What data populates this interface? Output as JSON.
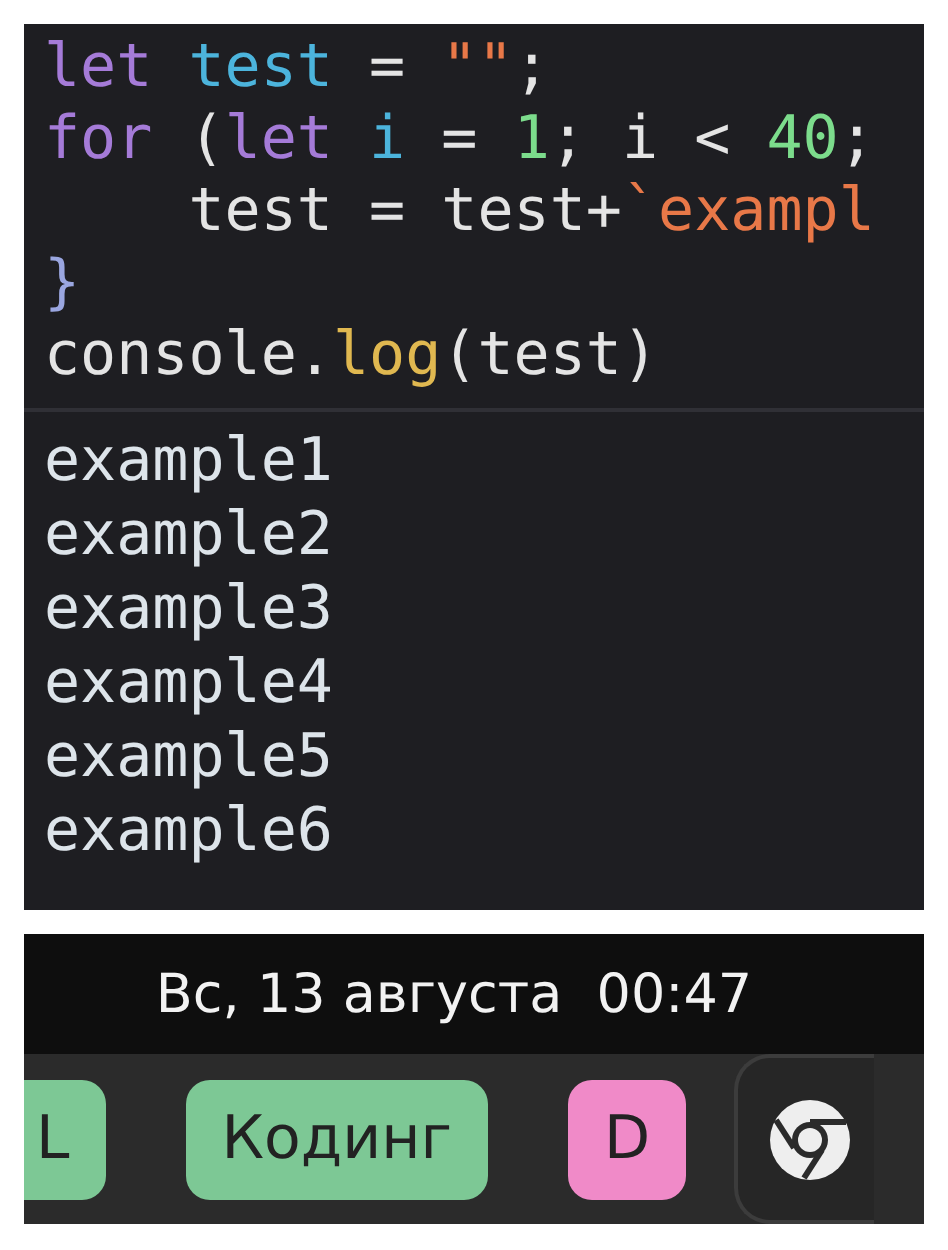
{
  "editor": {
    "code_lines": [
      [
        {
          "text": "let",
          "kind": "keyword"
        },
        {
          "text": " test",
          "kind": "variable"
        },
        {
          "text": " = ",
          "kind": "plain"
        },
        {
          "text": "\"\"",
          "kind": "string"
        },
        {
          "text": ";",
          "kind": "plain"
        }
      ],
      [
        {
          "text": "for",
          "kind": "keyword"
        },
        {
          "text": " (",
          "kind": "plain"
        },
        {
          "text": "let",
          "kind": "keyword"
        },
        {
          "text": " i",
          "kind": "variable"
        },
        {
          "text": " = ",
          "kind": "plain"
        },
        {
          "text": "1",
          "kind": "number"
        },
        {
          "text": "; i < ",
          "kind": "plain"
        },
        {
          "text": "40",
          "kind": "number"
        },
        {
          "text": ";",
          "kind": "plain"
        }
      ],
      [
        {
          "text": "    test = test+",
          "kind": "plain"
        },
        {
          "text": "`exampl",
          "kind": "string"
        }
      ],
      [
        {
          "text": "}",
          "kind": "bracket"
        }
      ],
      [
        {
          "text": "console.",
          "kind": "plain"
        },
        {
          "text": "log",
          "kind": "function"
        },
        {
          "text": "(test)",
          "kind": "plain"
        }
      ]
    ],
    "output_lines": [
      "example1",
      "example2",
      "example3",
      "example4",
      "example5",
      "example6"
    ]
  },
  "top_bar": {
    "clock": "Вс, 13 августа  00:47"
  },
  "workspace_tags": [
    {
      "label": "L",
      "color": "#7dc895"
    },
    {
      "label": "Кодинг",
      "color": "#7dc895"
    },
    {
      "label": "D",
      "color": "#f08ac8"
    }
  ]
}
